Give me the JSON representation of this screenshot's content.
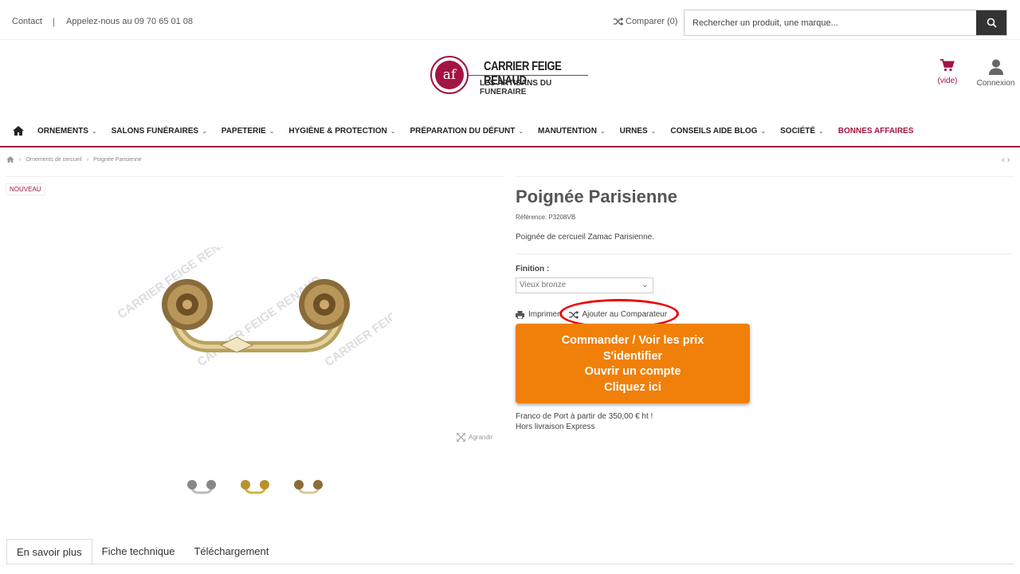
{
  "topbar": {
    "contact": "Contact",
    "separator": "|",
    "phone": "Appelez-nous au 09 70 65 01 08",
    "compare": "Comparer (0)",
    "search_placeholder": "Rechercher un produit, une marque..."
  },
  "logo": {
    "mark": "af",
    "brand": "CARRIER FEIGE RENAUD",
    "tagline": "LES ARTISANS DU FUNERAIRE"
  },
  "header": {
    "cart_label": "(vide)",
    "login_label": "Connexion"
  },
  "nav": {
    "items": [
      {
        "label": "ORNEMENTS",
        "chevron": "⌄"
      },
      {
        "label": "SALONS FUNÉRAIRES",
        "chevron": "⌄"
      },
      {
        "label": "PAPETERIE",
        "chevron": "⌄"
      },
      {
        "label": "HYGIÈNE & PROTECTION",
        "chevron": "⌄"
      },
      {
        "label": "PRÉPARATION DU DÉFUNT",
        "chevron": "⌄"
      },
      {
        "label": "MANUTENTION",
        "chevron": "⌄"
      },
      {
        "label": "URNES",
        "chevron": "⌄"
      },
      {
        "label": "CONSEILS AIDE BLOG",
        "chevron": "⌄"
      },
      {
        "label": "SOCIÉTÉ",
        "chevron": "⌄"
      },
      {
        "label": "BONNES AFFAIRES"
      }
    ]
  },
  "breadcrumb": {
    "items": [
      "Ornements de cercueil",
      "Poignée Parisienne"
    ],
    "pager": "‹ ›"
  },
  "product": {
    "badge": "NOUVEAU",
    "title": "Poignée Parisienne",
    "reference": "Référence: P3208VB",
    "description": "Poignée de cercueil Zamac Parisienne.",
    "finition_label": "Finition :",
    "finition_value": "Vieux bronze",
    "print_label": "Imprimer",
    "compare_label": "Ajouter au Comparateur",
    "enlarge_label": "Agrandir",
    "watermark": "CARRIER FEIGE RENAUD",
    "cta_lines": [
      "Commander / Voir les prix",
      "S'identifier",
      "Ouvrir un compte",
      "Cliquez ici"
    ],
    "shipping_line1": "Franco de Port à partir de 350,00 € ht !",
    "shipping_line2": "Hors livraison Express"
  },
  "tabs": [
    "En savoir plus",
    "Fiche technique",
    "Téléchargement"
  ],
  "colors": {
    "brand": "#a31540",
    "cta": "#f0800a",
    "highlight": "#e00000"
  }
}
